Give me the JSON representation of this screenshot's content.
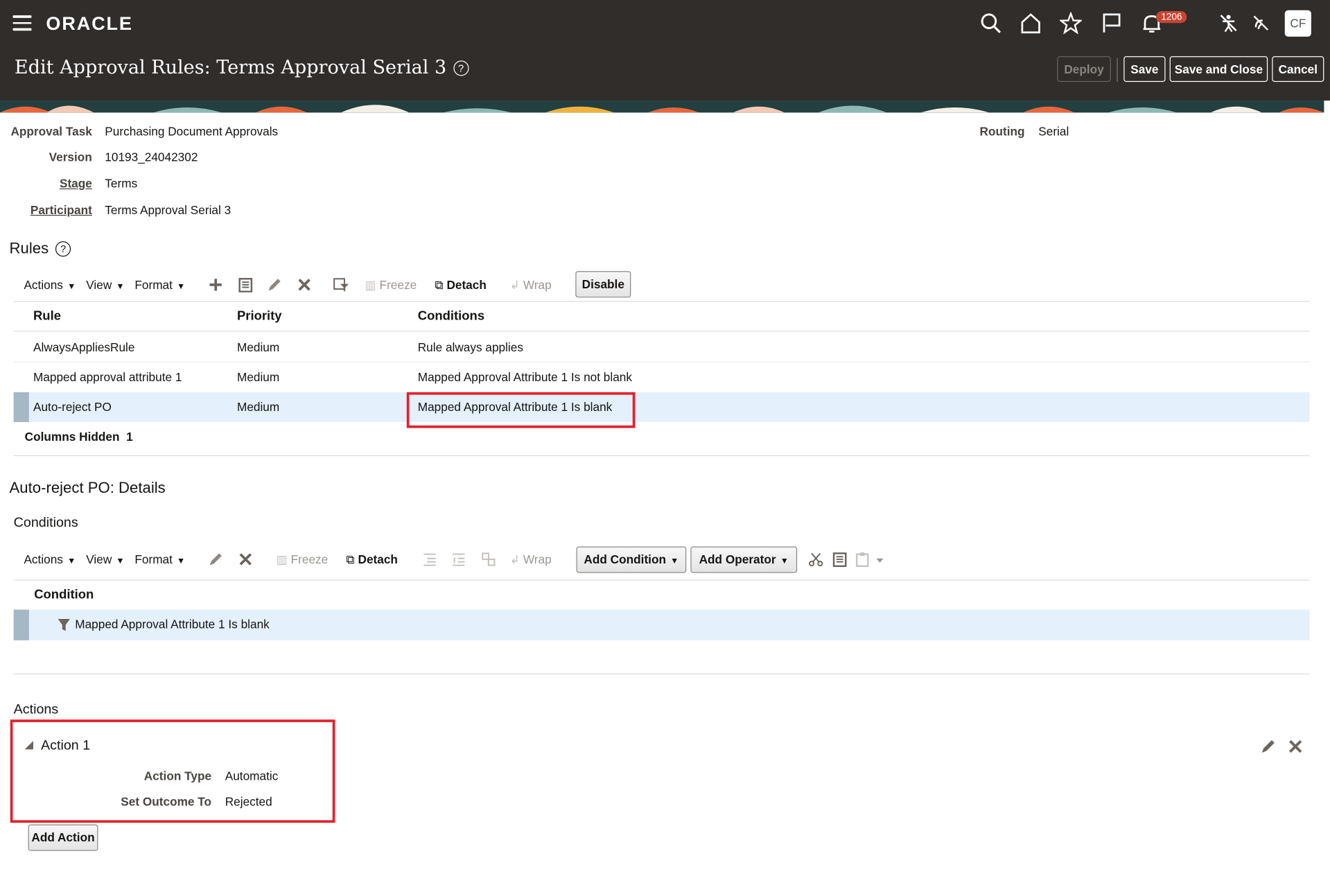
{
  "header": {
    "brand": "ORACLE",
    "title": "Edit Approval Rules: Terms Approval Serial 3",
    "help_glyph": "?",
    "notifications_count": "1206",
    "user_initials": "CF",
    "buttons": {
      "deploy": "Deploy",
      "save": "Save",
      "save_and_close": "Save and Close",
      "cancel": "Cancel"
    }
  },
  "info": {
    "approval_task_label": "Approval Task",
    "approval_task_value": "Purchasing Document Approvals",
    "version_label": "Version",
    "version_value": "10193_24042302",
    "stage_label": "Stage",
    "stage_value": "Terms",
    "participant_label": "Participant",
    "participant_value": "Terms Approval Serial 3",
    "routing_label": "Routing",
    "routing_value": "Serial"
  },
  "rules": {
    "title": "Rules",
    "toolbar": {
      "actions": "Actions",
      "view": "View",
      "format": "Format",
      "freeze": "Freeze",
      "detach": "Detach",
      "wrap": "Wrap",
      "disable": "Disable"
    },
    "columns": {
      "rule": "Rule",
      "priority": "Priority",
      "conditions": "Conditions"
    },
    "rows": [
      {
        "rule": "AlwaysAppliesRule",
        "priority": "Medium",
        "conditions": "Rule always applies"
      },
      {
        "rule": "Mapped approval attribute 1",
        "priority": "Medium",
        "conditions": "Mapped Approval Attribute 1 Is not blank"
      },
      {
        "rule": "Auto-reject PO",
        "priority": "Medium",
        "conditions": "Mapped Approval Attribute 1 Is blank"
      }
    ],
    "columns_hidden_label": "Columns Hidden",
    "columns_hidden_count": "1"
  },
  "details": {
    "title": "Auto-reject PO: Details",
    "conditions_title": "Conditions",
    "toolbar": {
      "actions": "Actions",
      "view": "View",
      "format": "Format",
      "freeze": "Freeze",
      "detach": "Detach",
      "wrap": "Wrap",
      "add_condition": "Add Condition",
      "add_operator": "Add Operator"
    },
    "condition_column": "Condition",
    "condition_row": "Mapped Approval Attribute 1 Is blank",
    "actions_title": "Actions",
    "action": {
      "name": "Action 1",
      "action_type_label": "Action Type",
      "action_type_value": "Automatic",
      "set_outcome_label": "Set Outcome To",
      "set_outcome_value": "Rejected"
    },
    "add_action": "Add Action"
  },
  "colors": {
    "header_bg": "#312d2a",
    "selected_row": "#e4f0fb",
    "highlight_box": "#e3202d",
    "badge": "#c74634"
  }
}
